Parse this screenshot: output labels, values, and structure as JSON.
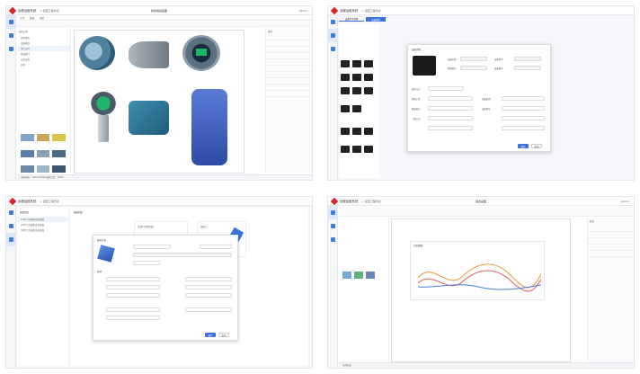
{
  "brand": "远程运维系统",
  "crumb": "< 返回工程列表",
  "q1": {
    "center_title": "新建组态画面",
    "user": "admin",
    "menu": [
      "文件",
      "编辑",
      "视图"
    ],
    "left_title": "图库分组",
    "tree": [
      "基本图形",
      "设备图库",
      "电气元件",
      "管道阀门",
      "仪表设备",
      "其他"
    ],
    "right_title": "属性",
    "status": "当前画布：1920×1080   缩放比例：100%"
  },
  "q2": {
    "tabs": [
      "设备型号管理",
      "设备管理"
    ],
    "dialog_title": "设备详情",
    "fields": [
      "设备名称",
      "设备型号",
      "所属网关",
      "设备编号",
      "通讯方式",
      "所属工程",
      "采集周期",
      "数据格式",
      "设备地址",
      "上报方式"
    ],
    "ok": "确定",
    "cancel": "取消"
  },
  "q3": {
    "left_title": "画面列表",
    "list": [
      "1#空气压缩机监控画面",
      "2#空气压缩机监控画面",
      "3#空气压缩机监控画面"
    ],
    "card_title": "可燃气体报警器",
    "card2": "画面二",
    "dialog_title": "基本信息",
    "section": "样式",
    "ok": "确定",
    "cancel": "取消"
  },
  "q4": {
    "center_title": "组态画面",
    "user": "admin",
    "chart_title": "历史曲线",
    "right_title": "属性",
    "status": "当前画布"
  },
  "colors": {
    "accent": "#3b74d6",
    "brand": "#d8262c"
  }
}
